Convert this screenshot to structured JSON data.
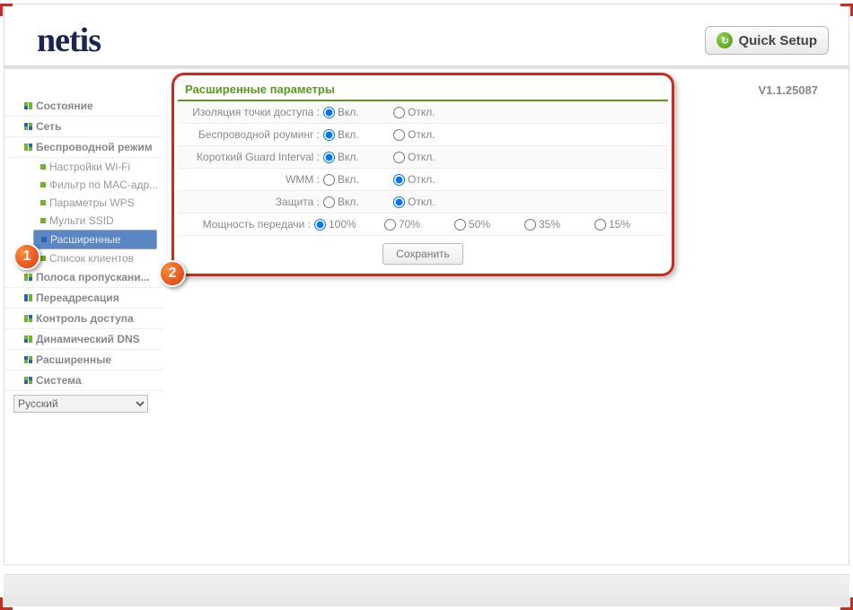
{
  "header": {
    "logo_text": "netis",
    "quick_setup_label": "Quick Setup",
    "version": "V1.1.25087"
  },
  "sidebar": {
    "items": [
      {
        "label": "Состояние"
      },
      {
        "label": "Сеть"
      },
      {
        "label": "Беспроводной режим"
      }
    ],
    "wireless_sub": [
      {
        "label": "Настройки Wi-Fi"
      },
      {
        "label": "Фильтр по MAC-адр..."
      },
      {
        "label": "Параметры WPS"
      },
      {
        "label": "Мульти SSID"
      },
      {
        "label": "Расширенные"
      },
      {
        "label": "Список клиентов"
      }
    ],
    "items_after": [
      {
        "label": "Полоса пропускани..."
      },
      {
        "label": "Переадресация"
      },
      {
        "label": "Контроль доступа"
      },
      {
        "label": "Динамический DNS"
      },
      {
        "label": "Расширенные"
      },
      {
        "label": "Система"
      }
    ],
    "language_selected": "Русский"
  },
  "panel": {
    "title": "Расширенные параметры",
    "rows": {
      "ap_isolation": {
        "label": "Изоляция точки доступа :",
        "on": "Вкл.",
        "off": "Откл.",
        "value": "on"
      },
      "roaming": {
        "label": "Беспроводной роуминг :",
        "on": "Вкл.",
        "off": "Откл.",
        "value": "on"
      },
      "short_gi": {
        "label": "Короткий Guard Interval :",
        "on": "Вкл.",
        "off": "Откл.",
        "value": "on"
      },
      "wmm": {
        "label": "WMM :",
        "on": "Вкл.",
        "off": "Откл.",
        "value": "off"
      },
      "protection": {
        "label": "Защита :",
        "on": "Вкл.",
        "off": "Откл.",
        "value": "off"
      },
      "tx_power": {
        "label": "Мощность передачи :",
        "opts": [
          "100%",
          "70%",
          "50%",
          "35%",
          "15%"
        ],
        "value": "100%"
      }
    },
    "save_label": "Сохранить"
  },
  "badges": {
    "one": "1",
    "two": "2"
  }
}
